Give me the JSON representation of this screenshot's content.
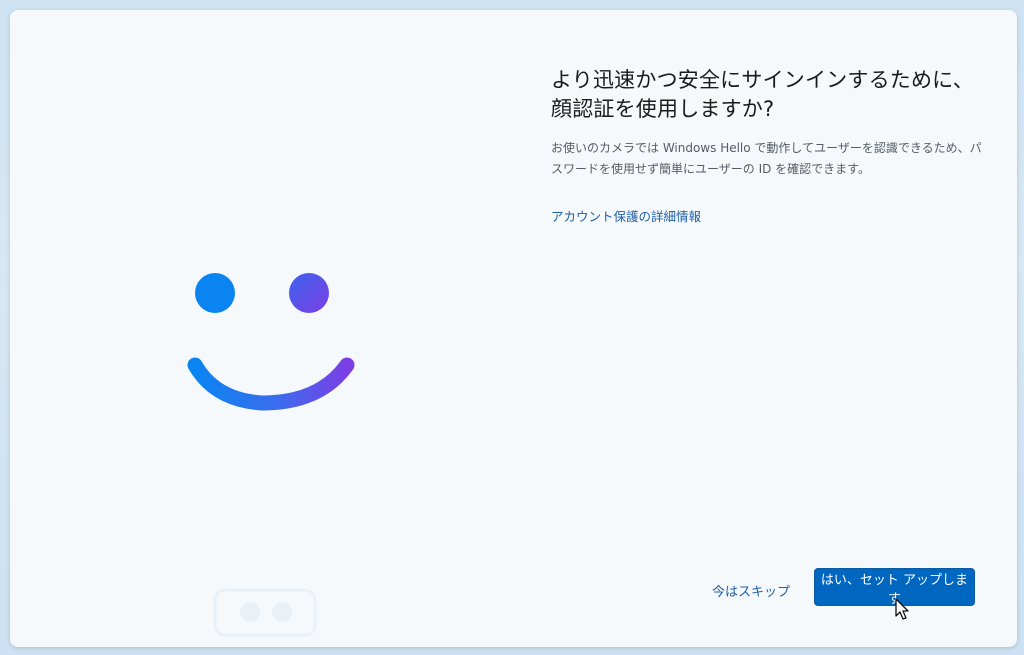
{
  "dialog": {
    "title": "より迅速かつ安全にサインインするために、顔認証を使用しますか?",
    "description": "お使いのカメラでは Windows Hello で動作してユーザーを認識できるため、パスワードを使用せず簡単にユーザーの ID を確認できます。",
    "link_label": "アカウント保護の詳細情報"
  },
  "actions": {
    "skip_label": "今はスキップ",
    "setup_label": "はい、セット アップします"
  },
  "illustration": {
    "icon": "windows-hello-smile-icon",
    "gradient_start": "#0a84f0",
    "gradient_end": "#7b3fe4"
  },
  "colors": {
    "primary_button": "#0067c0",
    "link": "#1f5fa6",
    "background": "#f5f9fc"
  }
}
